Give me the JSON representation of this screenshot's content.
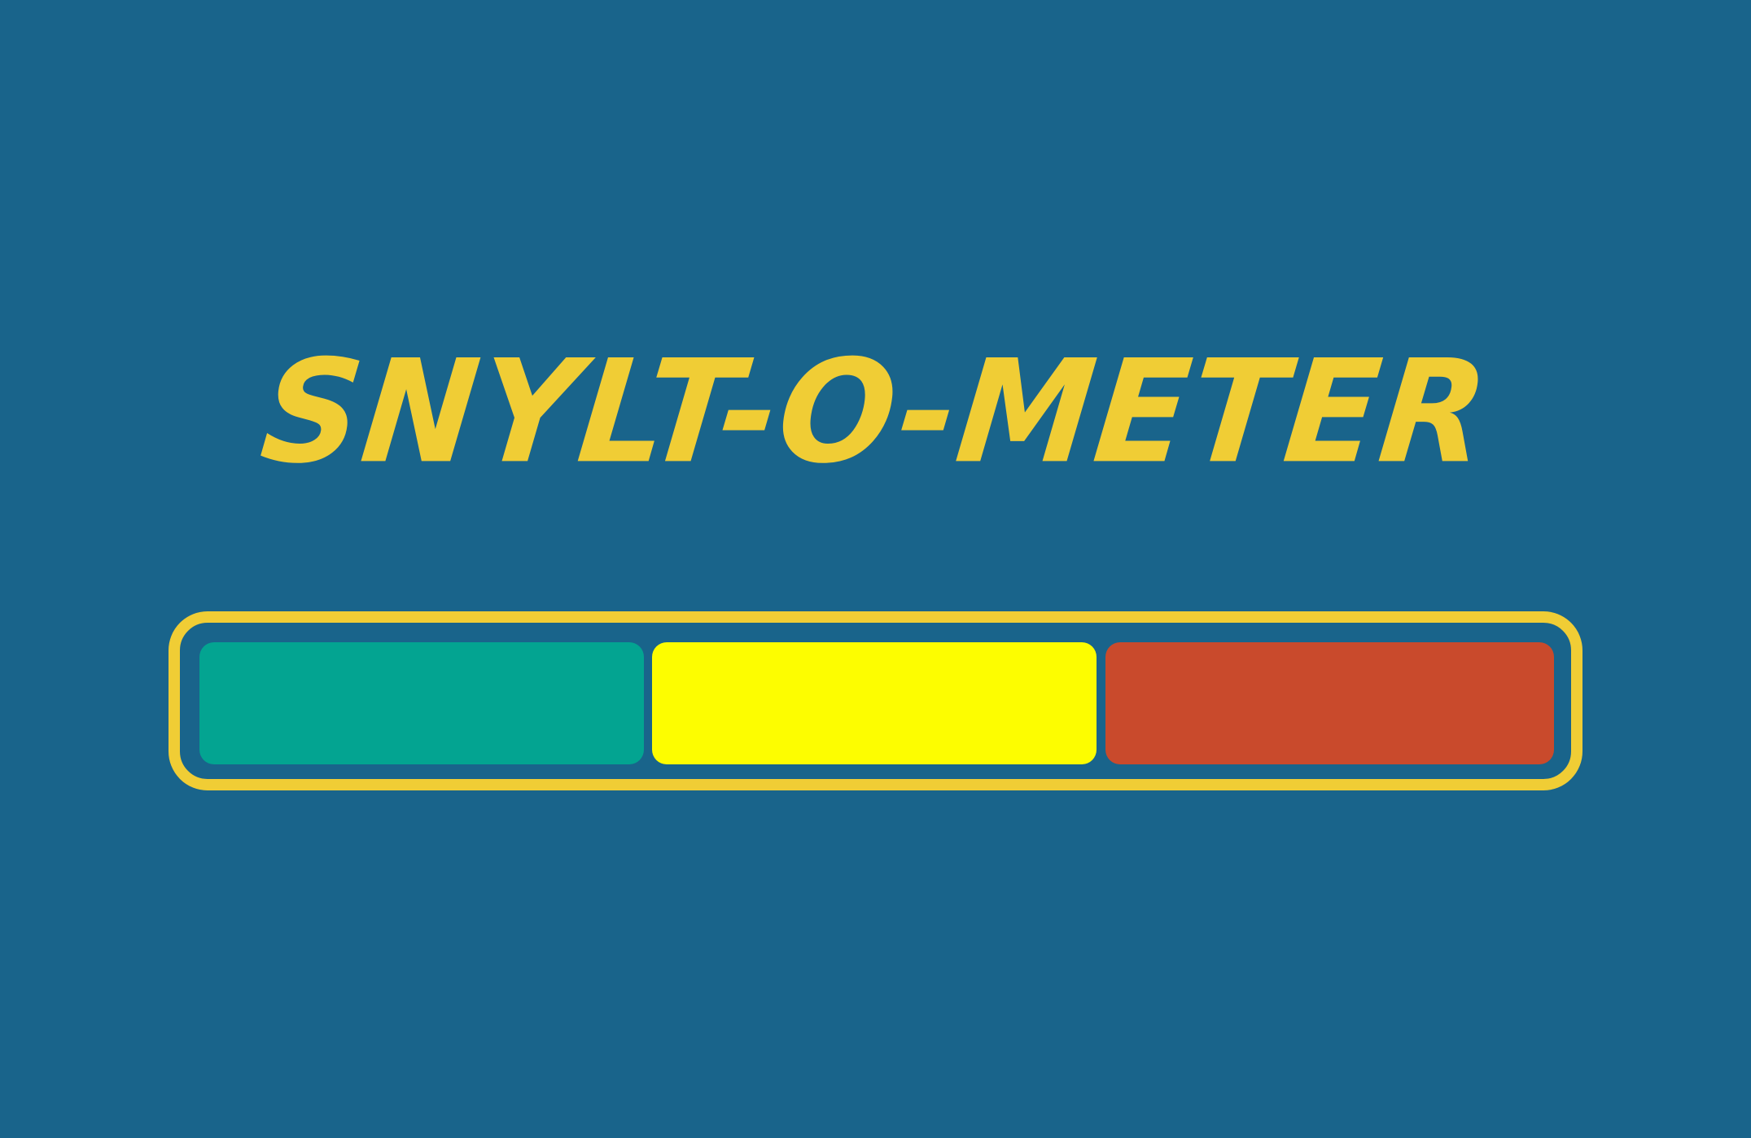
{
  "title": "SNYLT-O-METER",
  "colors": {
    "background": "#19648b",
    "accent": "#f0cd35",
    "green": "#03a491",
    "yellow": "#fdfd00",
    "red": "#c94a2c"
  },
  "meter": {
    "segments": [
      {
        "color": "#03a491"
      },
      {
        "color": "#fdfd00"
      },
      {
        "color": "#c94a2c"
      }
    ]
  }
}
